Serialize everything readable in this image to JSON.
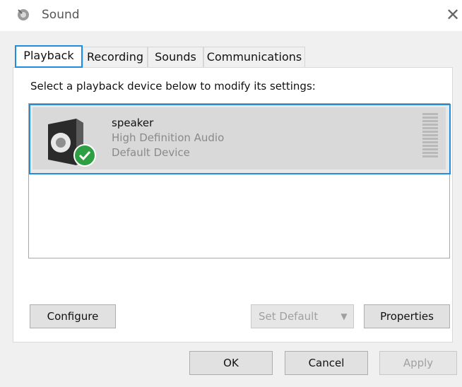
{
  "window": {
    "title": "Sound",
    "close_glyph": "✕",
    "icon": "speaker-icon"
  },
  "tabs": [
    {
      "label": "Playback",
      "selected": true
    },
    {
      "label": "Recording",
      "selected": false
    },
    {
      "label": "Sounds",
      "selected": false
    },
    {
      "label": "Communications",
      "selected": false
    }
  ],
  "playback": {
    "instruction": "Select a playback device below to modify its settings:",
    "devices": [
      {
        "name": "speaker",
        "driver": "High Definition Audio",
        "status": "Default Device",
        "icon": "speaker-icon",
        "badge": "default-check-icon",
        "selected": true
      }
    ]
  },
  "buttons": {
    "configure": "Configure",
    "set_default": "Set Default",
    "set_default_arrow": "▼",
    "properties": "Properties",
    "ok": "OK",
    "cancel": "Cancel",
    "apply": "Apply"
  },
  "colors": {
    "accent": "#1f8ee0",
    "check_green": "#2ea043",
    "panel_bg": "#f0f0f0"
  }
}
